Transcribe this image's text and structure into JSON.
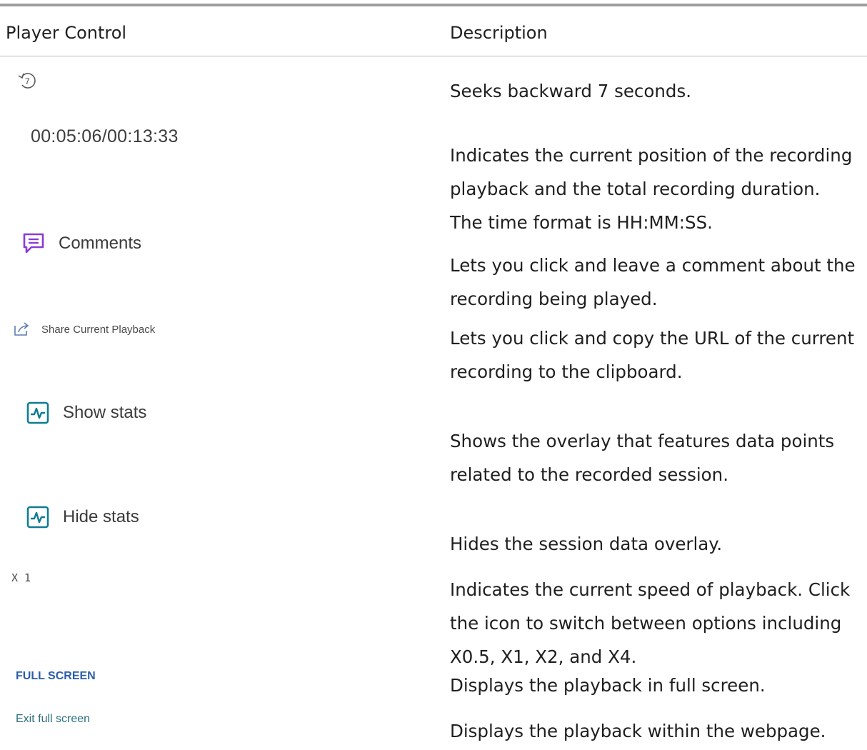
{
  "table": {
    "header_control": "Player Control",
    "header_description": "Description"
  },
  "controls": {
    "seek_back_digit": "7",
    "time_display": "00:05:06/00:13:33",
    "comments_label": "Comments",
    "share_label": "Share Current Playback",
    "show_stats_label": "Show stats",
    "hide_stats_label": "Hide stats",
    "speed_label": "X 1",
    "fullscreen_label": "FULL SCREEN",
    "exit_fullscreen_label": "Exit full screen"
  },
  "descriptions": {
    "seek_back": "Seeks backward 7 seconds.",
    "time": "Indicates the current position of the recording playback and the total recording duration. The time format is HH:MM:SS.",
    "comments": "Lets you click and leave a comment about the recording being played.",
    "share": "Lets you click and copy the URL of the current recording to the clipboard.",
    "show_stats": "Shows the overlay that features data points related to the recorded session.",
    "hide_stats": "Hides the session data overlay.",
    "speed": "Indicates the current speed of playback. Click the icon to switch between options including X0.5, X1, X2, and X4.",
    "fullscreen": "Displays the playback in full screen.",
    "exit_fullscreen": "Displays the playback within the webpage."
  },
  "icons": {
    "seek_back": "rewind-7-icon",
    "comments": "comment-icon",
    "share": "share-icon",
    "stats": "stats-icon"
  },
  "colors": {
    "comments_icon": "#8b3ad6",
    "stats_icon": "#0e7c95",
    "fullscreen_text": "#2b5da8",
    "exit_fullscreen_text": "#2b6f80"
  }
}
